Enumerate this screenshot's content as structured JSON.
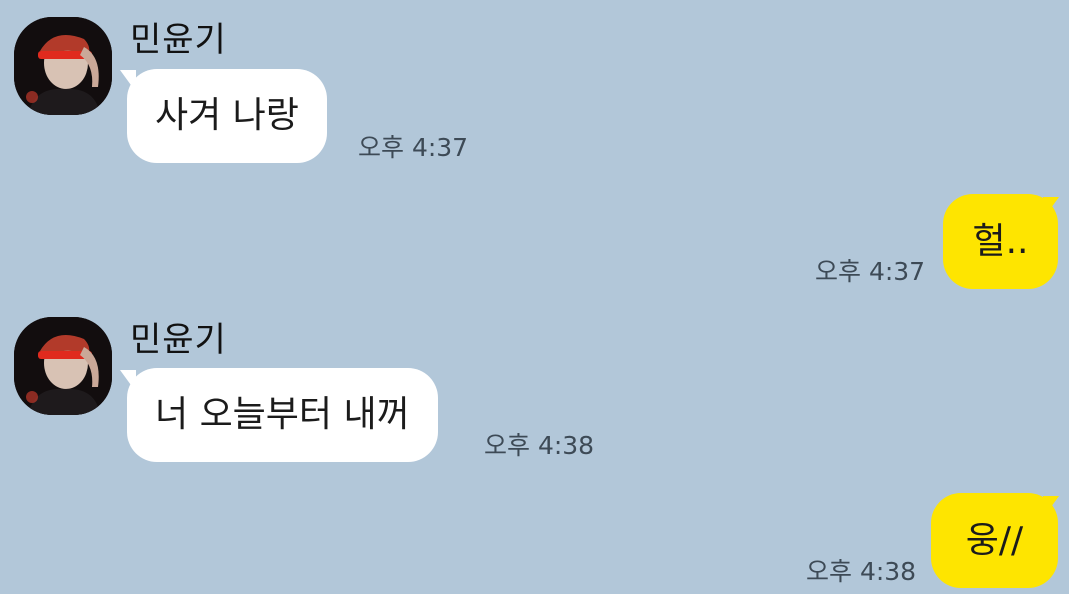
{
  "chat": {
    "messages": [
      {
        "direction": "received",
        "sender": "민윤기",
        "avatar_icon": "profile-photo",
        "text": "사겨 나랑",
        "time": "오후 4:37"
      },
      {
        "direction": "sent",
        "text": "헐..",
        "time": "오후 4:37"
      },
      {
        "direction": "received",
        "sender": "민윤기",
        "avatar_icon": "profile-photo",
        "text": "너 오늘부터 내꺼",
        "time": "오후 4:38"
      },
      {
        "direction": "sent",
        "text": "웅//",
        "time": "오후 4:38"
      }
    ]
  },
  "colors": {
    "background": "#b2c7d9",
    "received_bubble": "#ffffff",
    "sent_bubble": "#fee500",
    "timestamp": "#3d4a56"
  }
}
